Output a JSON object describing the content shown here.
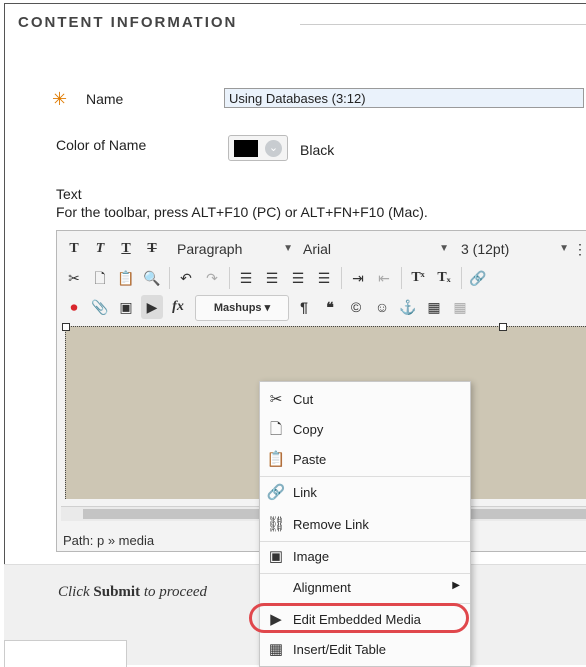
{
  "section": {
    "title": "CONTENT INFORMATION"
  },
  "form": {
    "name_label": "Name",
    "name_value": "Using Databases (3:12)",
    "color_label": "Color of Name",
    "color_value": "Black",
    "text_label": "Text",
    "toolbar_hint": "For the toolbar, press ALT+F10 (PC) or ALT+FN+F10 (Mac)."
  },
  "toolbar": {
    "paragraph": "Paragraph",
    "font": "Arial",
    "size": "3 (12pt)",
    "mashups": "Mashups"
  },
  "editor": {
    "path_label": "Path:",
    "path_value": "p » media"
  },
  "footer": {
    "hint_prefix": "Click ",
    "hint_bold": "Submit",
    "hint_suffix": " to proceed"
  },
  "context_menu": {
    "items": [
      {
        "label": "Cut",
        "icon": "scissors-icon"
      },
      {
        "label": "Copy",
        "icon": "copy-icon"
      },
      {
        "label": "Paste",
        "icon": "paste-icon"
      },
      {
        "label": "Link",
        "icon": "link-icon"
      },
      {
        "label": "Remove Link",
        "icon": "unlink-icon"
      },
      {
        "label": "Image",
        "icon": "image-icon"
      },
      {
        "label": "Alignment",
        "icon": "none"
      },
      {
        "label": "Edit Embedded Media",
        "icon": "media-icon"
      },
      {
        "label": "Insert/Edit Table",
        "icon": "table-icon"
      }
    ]
  },
  "colors": {
    "required_star": "#e07b00",
    "highlight_ring": "#e0474c",
    "canvas": "#cdc6b4"
  }
}
